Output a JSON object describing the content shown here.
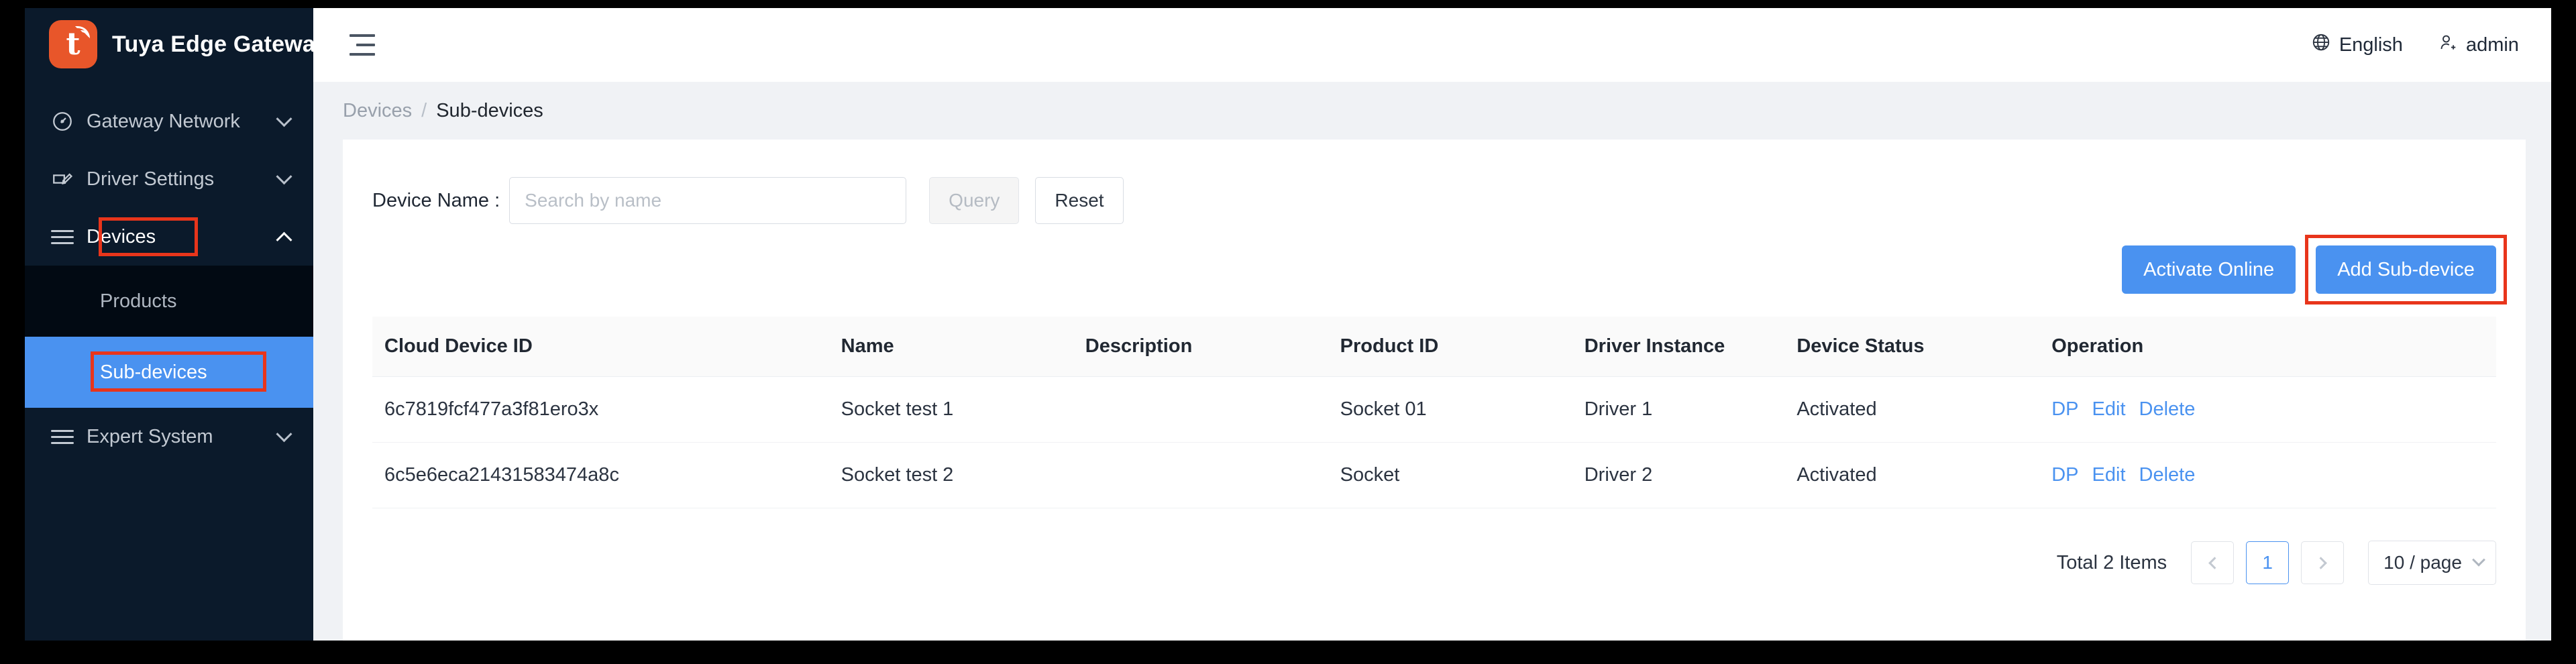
{
  "brand": {
    "title": "Tuya Edge Gateway",
    "logo_letter": "t"
  },
  "sidebar": {
    "items": [
      {
        "label": "Gateway Network",
        "icon": "gauge-icon",
        "caret": "down"
      },
      {
        "label": "Driver Settings",
        "icon": "edit-box-icon",
        "caret": "down"
      },
      {
        "label": "Devices",
        "icon": "menu-lines-icon",
        "caret": "up",
        "expanded": true
      },
      {
        "label": "Expert System",
        "icon": "menu-lines-icon",
        "caret": "down"
      }
    ],
    "submenu": [
      {
        "label": "Products",
        "selected": false
      },
      {
        "label": "Sub-devices",
        "selected": true
      }
    ]
  },
  "topbar": {
    "collapse_icon": "collapse-menu-icon",
    "language": "English",
    "language_icon": "globe-icon",
    "user": "admin",
    "user_icon": "user-add-icon"
  },
  "breadcrumb": {
    "parent": "Devices",
    "separator": "/",
    "current": "Sub-devices"
  },
  "filter": {
    "label": "Device Name :",
    "input_value": "",
    "placeholder": "Search by name",
    "query_label": "Query",
    "reset_label": "Reset"
  },
  "actions": {
    "activate_online": "Activate Online",
    "add_sub_device": "Add Sub-device"
  },
  "table": {
    "columns": [
      "Cloud Device ID",
      "Name",
      "Description",
      "Product ID",
      "Driver Instance",
      "Device Status",
      "Operation"
    ],
    "rows": [
      {
        "cloud_device_id": "6c7819fcf477a3f81ero3x",
        "name": "Socket test 1",
        "description": "",
        "product_id": "Socket 01",
        "driver_instance": "Driver 1",
        "device_status": "Activated",
        "operations": [
          "DP",
          "Edit",
          "Delete"
        ]
      },
      {
        "cloud_device_id": "6c5e6eca21431583474a8c",
        "name": "Socket test 2",
        "description": "",
        "product_id": "Socket",
        "driver_instance": "Driver 2",
        "device_status": "Activated",
        "operations": [
          "DP",
          "Edit",
          "Delete"
        ]
      }
    ]
  },
  "pagination": {
    "total_label": "Total 2 Items",
    "prev_icon": "chevron-left-icon",
    "next_icon": "chevron-right-icon",
    "current_page": "1",
    "page_size": "10 / page"
  },
  "colors": {
    "accent_blue": "#4a92f0",
    "brand_orange": "#e8562a",
    "sidebar_bg": "#0b1a2b",
    "submenu_bg": "#020a13",
    "status_green": "#27a544",
    "annotation_red": "#e8351b"
  }
}
